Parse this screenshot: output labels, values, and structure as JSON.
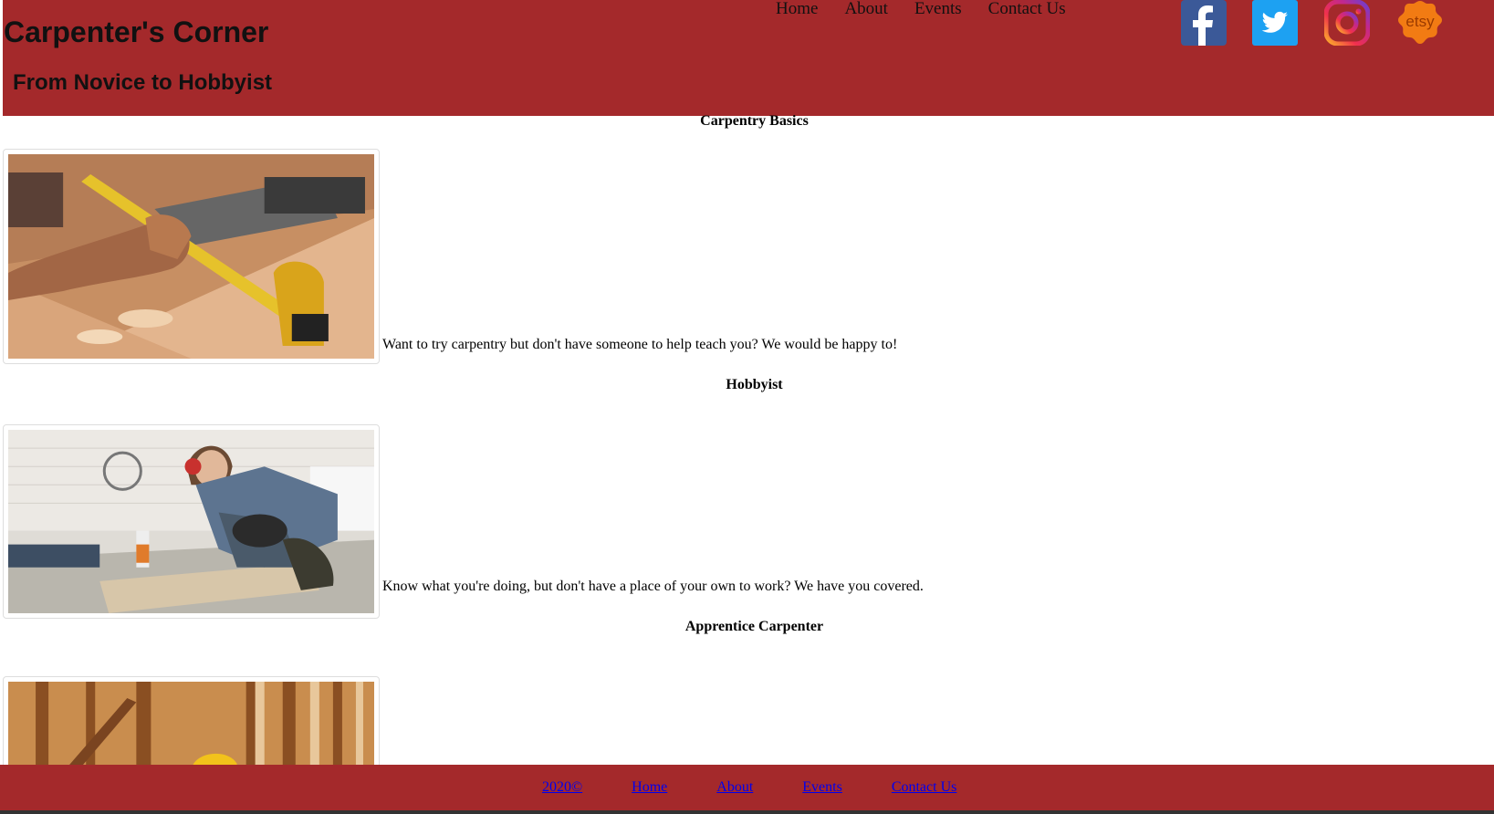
{
  "header": {
    "title": "Carpenter's Corner",
    "subtitle": "From Novice to Hobbyist",
    "nav": [
      "Home",
      "About",
      "Events",
      "Contact Us"
    ],
    "social": [
      {
        "name": "facebook",
        "icon": "facebook-icon",
        "color": "#3b5998"
      },
      {
        "name": "twitter",
        "icon": "twitter-icon",
        "color": "#1da1f2"
      },
      {
        "name": "instagram",
        "icon": "instagram-icon",
        "color": "#e1306c"
      },
      {
        "name": "etsy",
        "icon": "etsy-icon",
        "color": "#f56400",
        "label": "etsy"
      }
    ]
  },
  "sections": [
    {
      "heading": "Carpentry Basics",
      "text": "Want to try carpentry but don't have someone to help teach you? We would be happy to!"
    },
    {
      "heading": "Hobbyist",
      "text": "Know what you're doing, but don't have a place of your own to work? We have you covered."
    },
    {
      "heading": "Apprentice Carpenter",
      "text": ""
    }
  ],
  "footer": {
    "links": [
      "2020©",
      "Home",
      "About",
      "Events",
      "Contact Us"
    ]
  },
  "colors": {
    "header_bg": "#a4292b",
    "footer_bg": "#a4292b",
    "link": "#0000ee"
  }
}
